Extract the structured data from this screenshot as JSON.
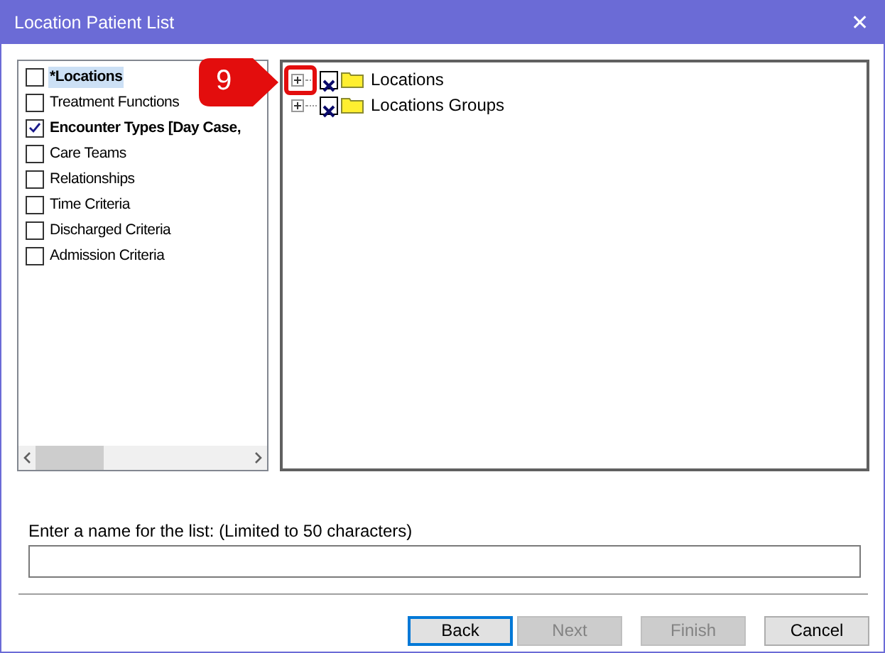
{
  "window": {
    "title": "Location Patient List",
    "close": "✕"
  },
  "criteria": [
    {
      "label": "*Locations",
      "checked": false,
      "bold": true,
      "selected": true
    },
    {
      "label": "Treatment Functions",
      "checked": false,
      "bold": false,
      "selected": false
    },
    {
      "label": "Encounter Types [Day Case,",
      "checked": true,
      "bold": true,
      "selected": false
    },
    {
      "label": "Care Teams",
      "checked": false,
      "bold": false,
      "selected": false
    },
    {
      "label": "Relationships",
      "checked": false,
      "bold": false,
      "selected": false
    },
    {
      "label": "Time Criteria",
      "checked": false,
      "bold": false,
      "selected": false
    },
    {
      "label": "Discharged Criteria",
      "checked": false,
      "bold": false,
      "selected": false
    },
    {
      "label": "Admission Criteria",
      "checked": false,
      "bold": false,
      "selected": false
    }
  ],
  "tree": [
    {
      "label": "Locations",
      "expanded": false,
      "excluded": true
    },
    {
      "label": "Locations Groups",
      "expanded": false,
      "excluded": true
    }
  ],
  "callout": {
    "number": "9"
  },
  "name_field": {
    "label": "Enter a name for the list: (Limited to 50 characters)"
  },
  "buttons": [
    {
      "label": "Back",
      "disabled": false,
      "default": true
    },
    {
      "label": "Next",
      "disabled": true,
      "default": false
    },
    {
      "label": "Finish",
      "disabled": true,
      "default": false
    },
    {
      "label": "Cancel",
      "disabled": false,
      "default": false
    }
  ]
}
